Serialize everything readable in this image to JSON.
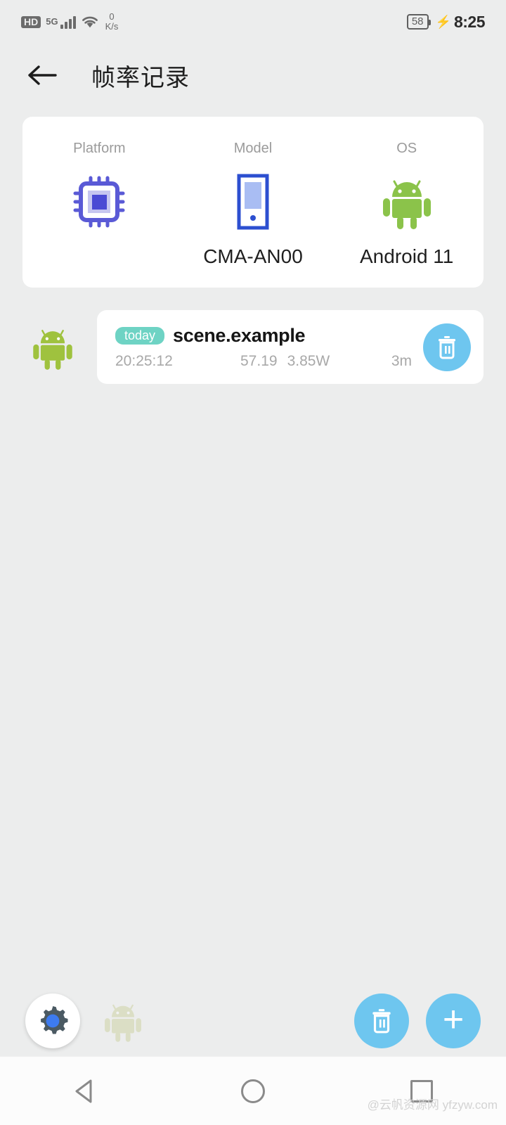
{
  "status_bar": {
    "hd_label": "HD",
    "network_type": "5G",
    "signal_icon": "signal-bars-icon",
    "wifi_icon": "wifi-icon",
    "net_speed_value": "0",
    "net_speed_unit": "K/s",
    "battery_level": "58",
    "charging_icon": "charging-bolt-icon",
    "time": "8:25"
  },
  "app_bar": {
    "back_icon": "arrow-left-icon",
    "title": "帧率记录"
  },
  "info_card": {
    "columns": [
      {
        "label": "Platform",
        "icon": "cpu-chip-icon",
        "value": ""
      },
      {
        "label": "Model",
        "icon": "phone-icon",
        "value": "CMA-AN00"
      },
      {
        "label": "OS",
        "icon": "android-robot-icon",
        "value": "Android 11"
      }
    ]
  },
  "records": [
    {
      "leading_icon": "android-robot-icon",
      "badge": "today",
      "name": "scene.example",
      "time": "20:25:12",
      "fps": "57.19",
      "power": "3.85W",
      "duration": "3m",
      "delete_icon": "trash-icon"
    }
  ],
  "bottom_bar": {
    "settings_icon": "gear-icon",
    "robot_icon": "android-robot-icon",
    "delete_all_icon": "trash-icon",
    "add_icon": "plus-icon",
    "add_label": "+"
  },
  "nav_bar": {
    "back_icon": "triangle-back-icon",
    "home_icon": "circle-home-icon",
    "recents_icon": "square-recents-icon"
  },
  "watermark": "@云帆资源网 yfzyw.com",
  "colors": {
    "background": "#eceded",
    "card": "#ffffff",
    "accent_blue": "#6ec6ef",
    "badge_teal": "#6ed3c4",
    "chip_purple": "#5a5ad6",
    "phone_blue": "#2c4fd0",
    "android_green": "#8bc34a",
    "row_android_green": "#9fc23e"
  }
}
